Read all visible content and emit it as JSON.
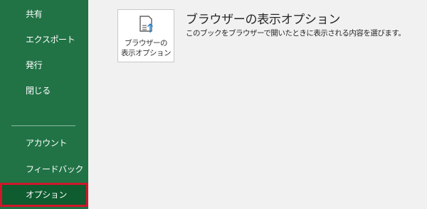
{
  "sidebar": {
    "items": [
      {
        "label": "共有"
      },
      {
        "label": "エクスポート"
      },
      {
        "label": "発行"
      },
      {
        "label": "閉じる"
      }
    ],
    "bottom_items": [
      {
        "label": "アカウント"
      },
      {
        "label": "フィードバック"
      },
      {
        "label": "オプション"
      }
    ],
    "selected": "オプション",
    "background_color": "#217346",
    "highlight_color": "#d0172a"
  },
  "main": {
    "tile": {
      "label_line1": "ブラウザーの",
      "label_line2": "表示オプション",
      "icon": "document-upload-icon"
    },
    "title": "ブラウザーの表示オプション",
    "description": "このブックをブラウザーで開いたときに表示される内容を選びます。"
  }
}
